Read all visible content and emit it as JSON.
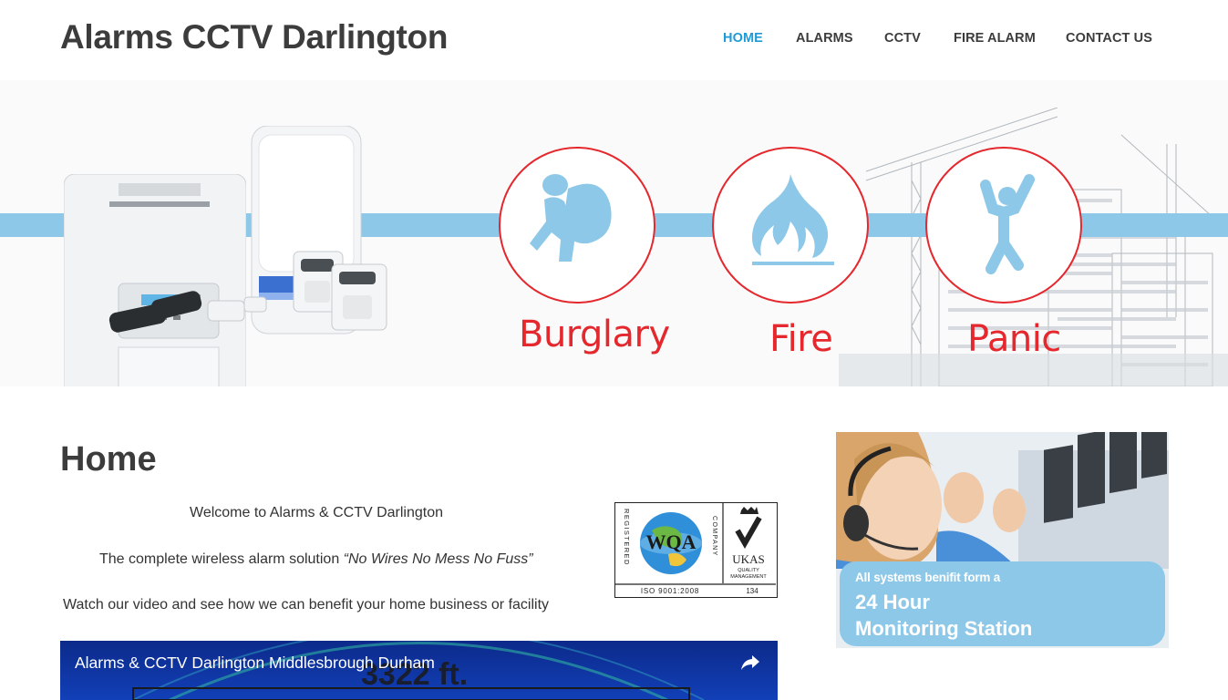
{
  "site": {
    "title": "Alarms CCTV Darlington"
  },
  "nav": {
    "items": [
      {
        "label": "HOME",
        "active": true
      },
      {
        "label": "ALARMS",
        "active": false
      },
      {
        "label": "CCTV",
        "active": false
      },
      {
        "label": "FIRE ALARM",
        "active": false
      },
      {
        "label": "CONTACT US",
        "active": false
      }
    ]
  },
  "hero": {
    "labels": [
      "Burglary",
      "Fire",
      "Panic"
    ],
    "icons": [
      "burglar-icon",
      "flame-icon",
      "panic-person-icon"
    ],
    "accent_color": "#e4282d",
    "stripe_color": "#8ec8e8"
  },
  "main": {
    "page_title": "Home",
    "welcome": "Welcome to Alarms & CCTV Darlington",
    "tagline_prefix": "The complete wireless alarm solution ",
    "tagline_quote": "“No Wires No Mess No Fuss”",
    "video_intro": "Watch our video and see how we can benefit your home business or facility",
    "certification": {
      "left_text": "REGISTERED",
      "logo": "WQA",
      "middle_text": "COMPANY",
      "ukas": "UKAS",
      "ukas_sub1": "QUALITY",
      "ukas_sub2": "MANAGEMENT",
      "iso": "ISO 9001:2008",
      "number": "134"
    },
    "video": {
      "title": "Alarms & CCTV Darlington Middlesbrough Durham",
      "frame_text": "3322 ft."
    }
  },
  "sidebar": {
    "ad": {
      "line1": "All systems benifit form a",
      "line2": "24 Hour",
      "line3": "Monitoring Station"
    }
  },
  "colors": {
    "nav_active": "#1e9ad6",
    "text_dark": "#3c3c3c",
    "video_bg": "#1240b8"
  }
}
